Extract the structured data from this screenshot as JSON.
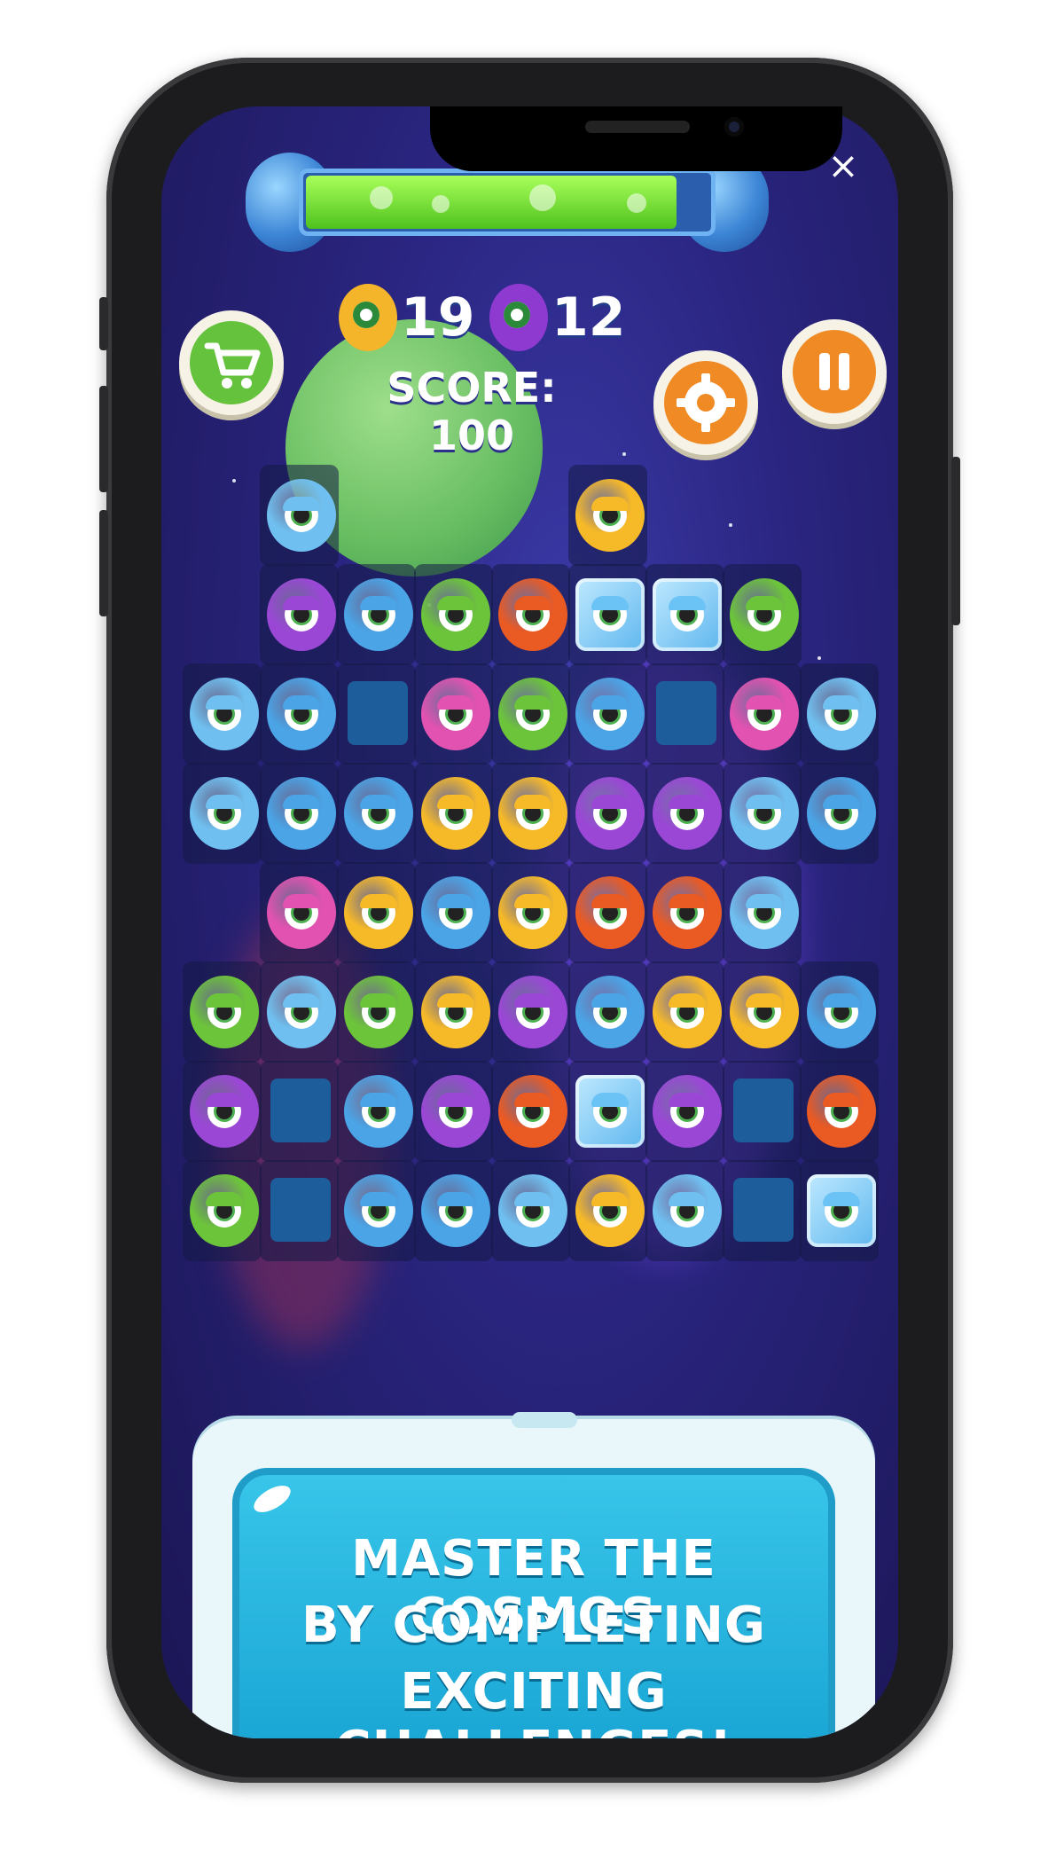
{
  "header": {
    "close_symbol": "×",
    "energy_level_percent": 92
  },
  "counters": [
    {
      "icon": "yellow-monster-icon",
      "value": "19",
      "color": "#f4b52a"
    },
    {
      "icon": "purple-monster-icon",
      "value": "12",
      "color": "#8e3ad1"
    }
  ],
  "score_text": "SCORE: 100",
  "buttons": {
    "shop": {
      "icon": "shopping-cart-icon",
      "color": "#64c23c"
    },
    "settings": {
      "icon": "gear-icon",
      "color": "#f08a24"
    },
    "pause": {
      "icon": "pause-icon",
      "color": "#f08a24"
    }
  },
  "board": {
    "colors": {
      "B": "#4aa4e6",
      "L": "#6fc0f0",
      "P": "#9b47d6",
      "G": "#6cc43a",
      "R": "#ea5a23",
      "Y": "#f6b928",
      "K": "#e252b0",
      "I": "#6bc3f5"
    },
    "rows": [
      [
        "-",
        "L",
        "-",
        "-",
        "-",
        "Y",
        "-",
        "-",
        "-"
      ],
      [
        "-",
        "P",
        "B",
        "G",
        "R",
        "I",
        "I",
        "G",
        "-"
      ],
      [
        "L",
        "B",
        "S",
        "K",
        "G",
        "B",
        "S",
        "K",
        "L"
      ],
      [
        "L",
        "B",
        "B",
        "Y",
        "Y",
        "P",
        "P",
        "L",
        "B"
      ],
      [
        "-",
        "K",
        "Y",
        "B",
        "Y",
        "R",
        "R",
        "L",
        "-"
      ],
      [
        "G",
        "L",
        "G",
        "Y",
        "P",
        "B",
        "Y",
        "Y",
        "B"
      ],
      [
        "P",
        "S",
        "B",
        "P",
        "R",
        "I",
        "P",
        "S",
        "R"
      ],
      [
        "G",
        "S",
        "B",
        "B",
        "L",
        "Y",
        "L",
        "S",
        "I"
      ]
    ]
  },
  "banner": {
    "lines": [
      "MASTER THE COSMOS",
      "BY COMPLETING",
      "EXCITING CHALLENGES!"
    ]
  }
}
